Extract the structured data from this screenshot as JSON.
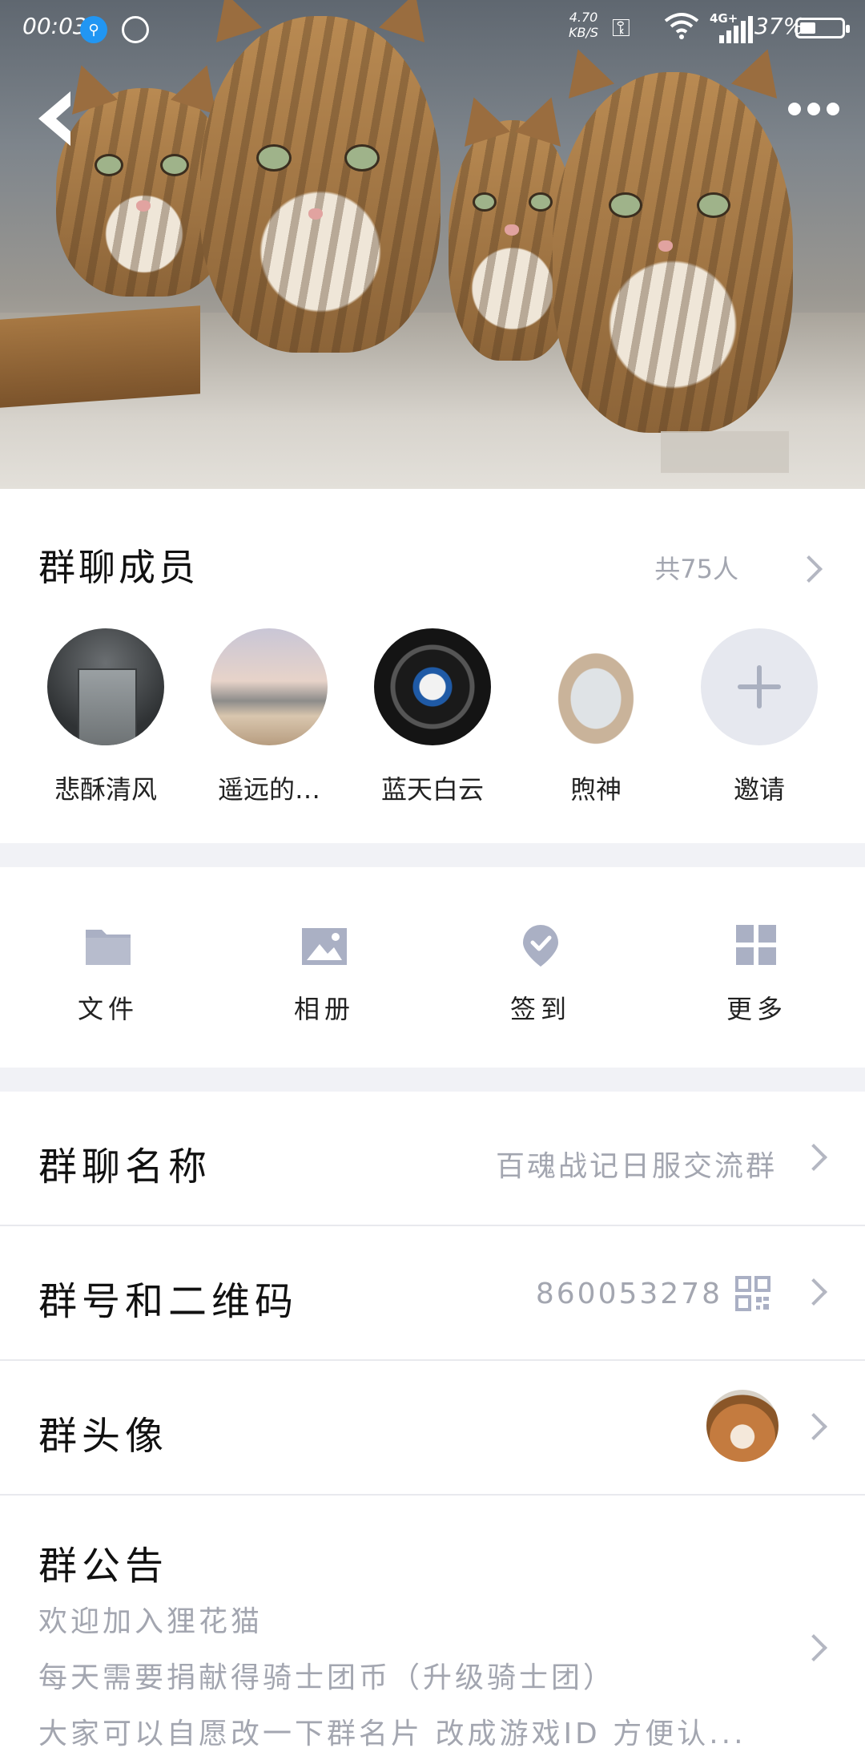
{
  "status_bar": {
    "time": "00:03",
    "net_speed_value": "4.70",
    "net_speed_unit": "KB/S",
    "network_type": "4G+",
    "battery_text": "37%",
    "battery_level": 0.37
  },
  "members": {
    "title": "群聊成员",
    "count_text": "共75人",
    "list": [
      {
        "name": "悲酥清风"
      },
      {
        "name": "遥远的…"
      },
      {
        "name": "蓝天白云"
      },
      {
        "name": "煦神"
      }
    ],
    "invite_label": "邀请"
  },
  "tools": [
    {
      "label": "文件",
      "icon": "folder-icon"
    },
    {
      "label": "相册",
      "icon": "image-icon"
    },
    {
      "label": "签到",
      "icon": "checkin-icon"
    },
    {
      "label": "更多",
      "icon": "grid-icon"
    }
  ],
  "settings": {
    "group_name_label": "群聊名称",
    "group_name_value": "百魂战记日服交流群",
    "group_id_label": "群号和二维码",
    "group_id_value": "860053278",
    "group_avatar_label": "群头像"
  },
  "notice": {
    "label": "群公告",
    "lines": [
      "欢迎加入狸花猫",
      "每天需要捐献得骑士团币（升级骑士团）",
      "大家可以自愿改一下群名片 改成游戏ID 方便认..."
    ]
  },
  "colors": {
    "accent_icon": "#aab0c4",
    "muted_text": "#a3a6b0",
    "divider": "#f1f2f6"
  }
}
